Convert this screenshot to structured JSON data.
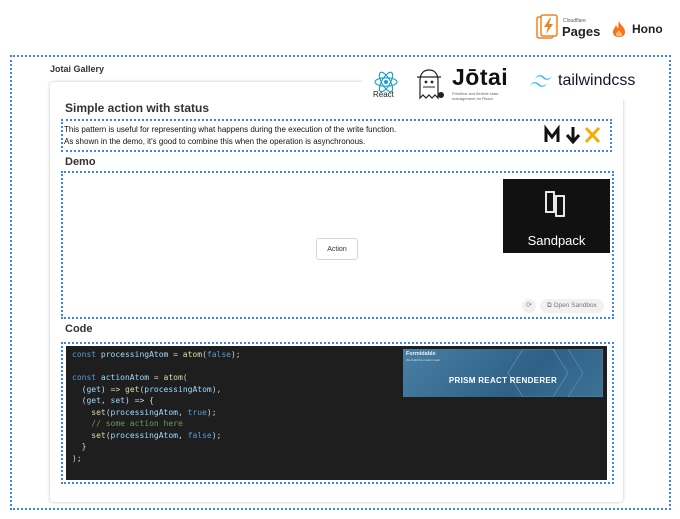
{
  "brands": {
    "cloudflare_small": "Cloudflare",
    "cloudflare_pages": "Pages",
    "hono": "Hono",
    "react": "React",
    "jotai": "Jōtai",
    "jotai_tagline": "Primitive and flexible state management for React",
    "tailwind": "tailwindcss",
    "sandpack": "Sandpack",
    "prism_brand": "Formidable",
    "prism_sub": "We build the modern web",
    "prism_title": "PRISM REACT RENDERER"
  },
  "gallery": {
    "title": "Jotai Gallery"
  },
  "page": {
    "title": "Simple action with status",
    "description": [
      "This pattern is useful for representing what happens during the execution of the write function.",
      "As shown in the demo, it's good to combine this when the operation is asynchronous."
    ]
  },
  "demo": {
    "heading": "Demo",
    "action_label": "Action",
    "open_sandbox_label": "Open Sandbox"
  },
  "code": {
    "heading": "Code",
    "lines": [
      [
        {
          "t": "const ",
          "c": "kw"
        },
        {
          "t": "processingAtom",
          "c": "var"
        },
        {
          "t": " = ",
          "c": "p"
        },
        {
          "t": "atom",
          "c": "fn"
        },
        {
          "t": "(",
          "c": "p"
        },
        {
          "t": "false",
          "c": "kw"
        },
        {
          "t": ");",
          "c": "p"
        }
      ],
      [],
      [
        {
          "t": "const ",
          "c": "kw"
        },
        {
          "t": "actionAtom",
          "c": "var"
        },
        {
          "t": " = ",
          "c": "p"
        },
        {
          "t": "atom",
          "c": "fn"
        },
        {
          "t": "(",
          "c": "p"
        }
      ],
      [
        {
          "t": "  (",
          "c": "p"
        },
        {
          "t": "get",
          "c": "var"
        },
        {
          "t": ") => ",
          "c": "p"
        },
        {
          "t": "get",
          "c": "fn"
        },
        {
          "t": "(",
          "c": "p"
        },
        {
          "t": "processingAtom",
          "c": "var"
        },
        {
          "t": "),",
          "c": "p"
        }
      ],
      [
        {
          "t": "  (",
          "c": "p"
        },
        {
          "t": "get",
          "c": "var"
        },
        {
          "t": ", ",
          "c": "p"
        },
        {
          "t": "set",
          "c": "var"
        },
        {
          "t": ") => {",
          "c": "p"
        }
      ],
      [
        {
          "t": "    ",
          "c": "p"
        },
        {
          "t": "set",
          "c": "fn"
        },
        {
          "t": "(",
          "c": "p"
        },
        {
          "t": "processingAtom",
          "c": "var"
        },
        {
          "t": ", ",
          "c": "p"
        },
        {
          "t": "true",
          "c": "kw"
        },
        {
          "t": ");",
          "c": "p"
        }
      ],
      [
        {
          "t": "    // some action here",
          "c": "cm"
        }
      ],
      [
        {
          "t": "    ",
          "c": "p"
        },
        {
          "t": "set",
          "c": "fn"
        },
        {
          "t": "(",
          "c": "p"
        },
        {
          "t": "processingAtom",
          "c": "var"
        },
        {
          "t": ", ",
          "c": "p"
        },
        {
          "t": "false",
          "c": "kw"
        },
        {
          "t": ");",
          "c": "p"
        }
      ],
      [
        {
          "t": "  }",
          "c": "p"
        }
      ],
      [
        {
          "t": ");",
          "c": "p"
        }
      ]
    ]
  },
  "colors": {
    "kw": "#569cd6",
    "var": "#9cdcfe",
    "fn": "#dcdcaa",
    "p": "#d4d4d4",
    "cm": "#6a9955",
    "dotted": "#3b82f6"
  }
}
